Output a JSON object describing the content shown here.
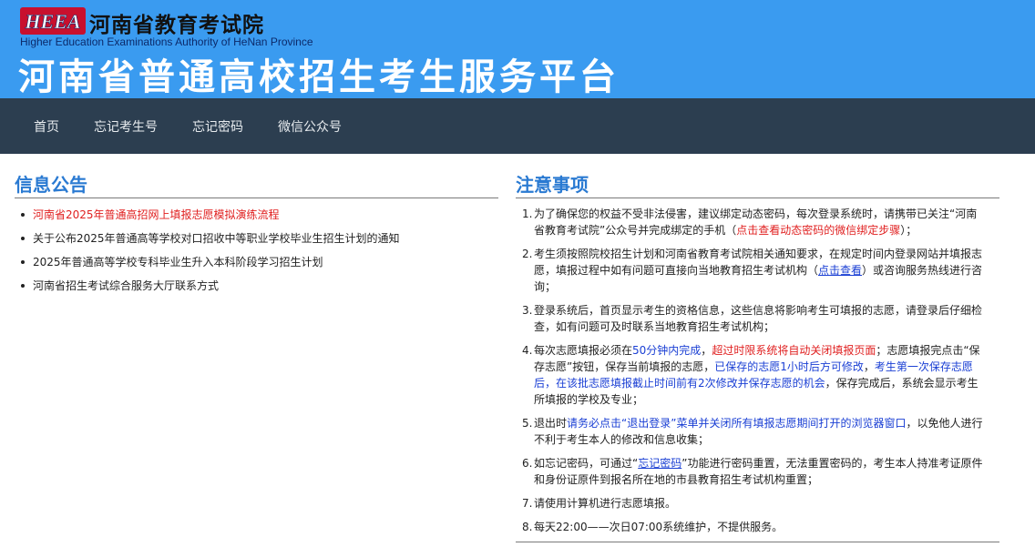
{
  "header": {
    "logo_text": "HEEA",
    "org_name_cn": "河南省教育考试院",
    "org_name_en": "Higher Education Examinations Authority of HeNan Province",
    "platform_title": "河南省普通高校招生考生服务平台",
    "bg_color": "#3a9bf0"
  },
  "nav": {
    "bg_color": "#2c3e50",
    "items": [
      {
        "label": "首页"
      },
      {
        "label": "忘记考生号"
      },
      {
        "label": "忘记密码"
      },
      {
        "label": "微信公众号"
      }
    ]
  },
  "news": {
    "title": "信息公告",
    "items": [
      {
        "text": "河南省2025年普通高招网上填报志愿模拟演练流程",
        "highlight": true
      },
      {
        "text": "关于公布2025年普通高等学校对口招收中等职业学校毕业生招生计划的通知",
        "highlight": false
      },
      {
        "text": "2025年普通高等学校专科毕业生升入本科阶段学习招生计划",
        "highlight": false
      },
      {
        "text": "河南省招生考试综合服务大厅联系方式",
        "highlight": false
      }
    ]
  },
  "notice": {
    "title": "注意事项",
    "items": [
      {
        "num": "1.",
        "parts": [
          {
            "t": "为了确保您的权益不受非法侵害，建议绑定动态密码，每次登录系统时，请携带已关注“河南省教育考试院”公众号并完成绑定的手机（",
            "s": ""
          },
          {
            "t": "点击查看动态密码的微信绑定步骤",
            "s": "redlink"
          },
          {
            "t": "）；",
            "s": ""
          }
        ]
      },
      {
        "num": "2.",
        "parts": [
          {
            "t": "考生须按照院校招生计划和河南省教育考试院相关通知要求，在规定时间内登录网站并填报志愿，填报过程中如有问题可直接向当地教育招生考试机构（",
            "s": ""
          },
          {
            "t": "点击查看",
            "s": "link"
          },
          {
            "t": "）或咨询服务热线进行咨询；",
            "s": ""
          }
        ]
      },
      {
        "num": "3.",
        "parts": [
          {
            "t": "登录系统后，首页显示考生的资格信息，这些信息将影响考生可填报的志愿，请登录后仔细检查，如有问题可及时联系当地教育招生考试机构；",
            "s": ""
          }
        ]
      },
      {
        "num": "4.",
        "parts": [
          {
            "t": "每次志愿填报必须在",
            "s": ""
          },
          {
            "t": "50分钟内完成",
            "s": "blue"
          },
          {
            "t": "，",
            "s": ""
          },
          {
            "t": "超过时限系统将自动关闭填报页面",
            "s": "red"
          },
          {
            "t": "；志愿填报完点击“保存志愿”按钮，保存当前填报的志愿，",
            "s": ""
          },
          {
            "t": "已保存的志愿1小时后方可修改",
            "s": "blue"
          },
          {
            "t": "，",
            "s": ""
          },
          {
            "t": "考生第一次保存志愿后，在该批志愿填报截止时间前有2次修改并保存志愿的机会",
            "s": "blue"
          },
          {
            "t": "，保存完成后，系统会显示考生所填报的学校及专业；",
            "s": ""
          }
        ]
      },
      {
        "num": "5.",
        "parts": [
          {
            "t": "退出时",
            "s": ""
          },
          {
            "t": "请务必点击“退出登录”菜单并关闭所有填报志愿期间打开的浏览器窗口",
            "s": "blue"
          },
          {
            "t": "，以免他人进行不利于考生本人的修改和信息收集；",
            "s": ""
          }
        ]
      },
      {
        "num": "6.",
        "parts": [
          {
            "t": "如忘记密码，可通过“",
            "s": ""
          },
          {
            "t": "忘记密码",
            "s": "link"
          },
          {
            "t": "”功能进行密码重置，无法重置密码的，考生本人持准考证原件和身份证原件到报名所在地的市县教育招生考试机构重置；",
            "s": ""
          }
        ]
      },
      {
        "num": "7.",
        "parts": [
          {
            "t": "请使用计算机进行志愿填报。",
            "s": ""
          }
        ]
      },
      {
        "num": "8.",
        "parts": [
          {
            "t": "每天22:00——次日07:00系统维护，不提供服务。",
            "s": ""
          }
        ]
      }
    ]
  }
}
